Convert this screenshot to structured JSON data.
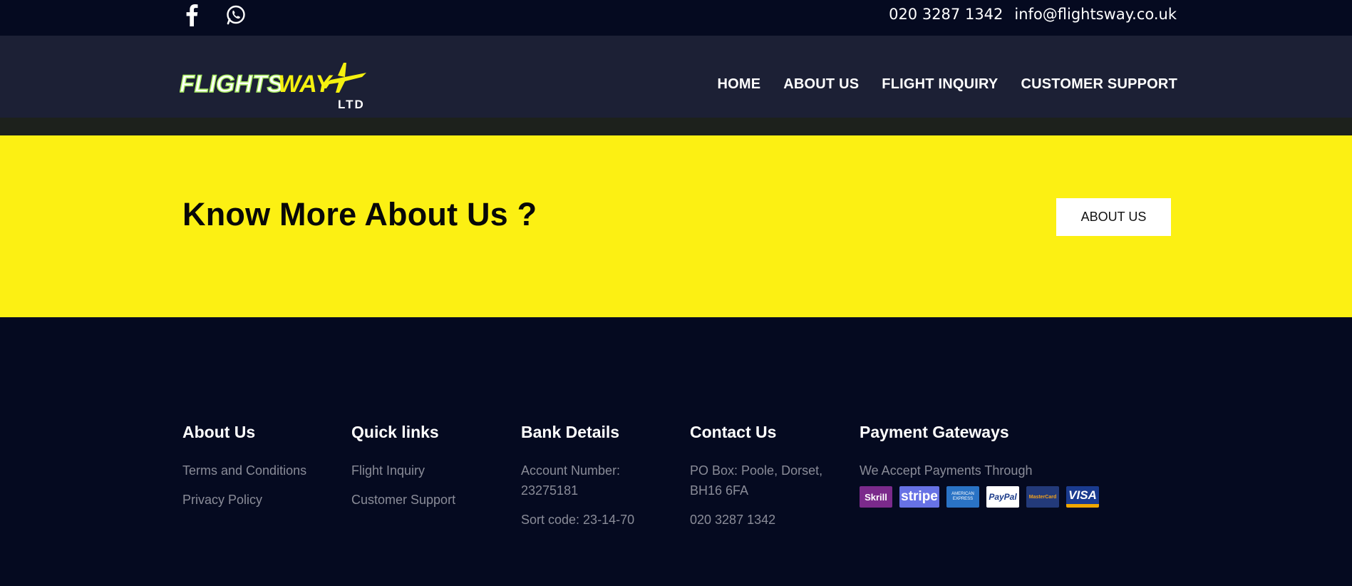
{
  "topbar": {
    "phone": "020 3287 1342",
    "email": "info@flightsway.co.uk",
    "social": [
      "facebook-icon",
      "whatsapp-icon"
    ]
  },
  "logo": {
    "word1": "FLIGHTS",
    "word2": "WAY",
    "suffix": "LTD"
  },
  "nav": {
    "items": [
      {
        "label": "HOME"
      },
      {
        "label": "ABOUT US"
      },
      {
        "label": "FLIGHT INQUIRY"
      },
      {
        "label": "CUSTOMER SUPPORT"
      }
    ]
  },
  "banner": {
    "title": "Know More About Us ?",
    "button": "ABOUT US"
  },
  "footer": {
    "about": {
      "heading": "About Us",
      "links": [
        "Terms and Conditions",
        "Privacy Policy"
      ]
    },
    "quick": {
      "heading": "Quick links",
      "links": [
        "Flight Inquiry",
        "Customer Support"
      ]
    },
    "bank": {
      "heading": "Bank Details",
      "account_label": "Account Number:",
      "account_number": "23275181",
      "sort_code": "Sort code: 23-14-70"
    },
    "contact": {
      "heading": "Contact Us",
      "address_line1": "PO Box: Poole, Dorset,",
      "address_line2": "BH16 6FA",
      "phone": "020 3287 1342"
    },
    "payments": {
      "heading": "Payment Gateways",
      "text": "We Accept Payments Through",
      "methods": [
        "Skrill",
        "stripe",
        "AMERICAN EXPRESS",
        "PayPal",
        "MasterCard",
        "VISA"
      ]
    }
  },
  "colors": {
    "banner": "#fcf013",
    "nav_bg": "#1c2035",
    "topbar_bg": "#050a20",
    "logo_green": "#a6ea5f",
    "logo_yellow": "#f4f00f"
  }
}
